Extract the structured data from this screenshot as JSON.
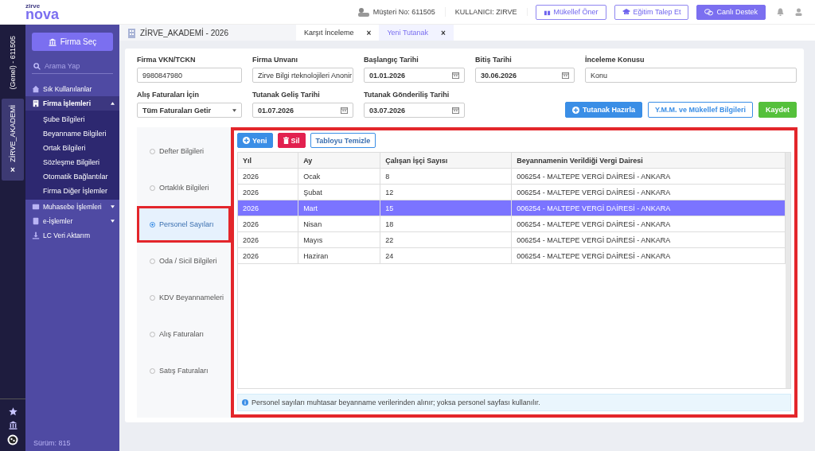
{
  "header": {
    "logo_small": "zirve",
    "logo": "nova",
    "customer": "Müşteri No: 611505",
    "user": "KULLANICI: ZIRVE",
    "buttons": [
      {
        "label": "Mükellef Öner",
        "kind": "outline"
      },
      {
        "label": "Eğitim Talep Et",
        "kind": "outline"
      },
      {
        "label": "Canlı Destek",
        "kind": "filled"
      }
    ]
  },
  "rail": {
    "label": "(Genel) - 611505",
    "tab": "ZİRVE_AKADEMİ",
    "close": "×"
  },
  "sidebar": {
    "select_button": "Firma Seç",
    "search": {
      "placeholder": "Arama Yap"
    },
    "items": [
      {
        "label": "Sık Kullanılanlar",
        "expanded": false
      },
      {
        "label": "Firma İşlemleri",
        "expanded": true,
        "children": [
          {
            "label": "Şube Bilgileri"
          },
          {
            "label": "Beyanname Bilgileri"
          },
          {
            "label": "Ortak Bilgileri"
          },
          {
            "label": "Sözleşme Bilgileri"
          },
          {
            "label": "Otomatik Bağlantılar"
          },
          {
            "label": "Firma Diğer İşlemler"
          }
        ]
      },
      {
        "label": "Muhasebe İşlemleri",
        "expanded": false,
        "has_children": true
      },
      {
        "label": "e-İşlemler",
        "expanded": false,
        "has_children": true
      },
      {
        "label": "LC Veri Aktarım",
        "expanded": false
      }
    ],
    "version": "Sürüm: 815"
  },
  "company": "ZİRVE_AKADEMİ - 2026",
  "tabs": [
    {
      "label": "Karşıt İnceleme",
      "close": "×",
      "selected": false
    },
    {
      "label": "Yeni Tutanak",
      "close": "×",
      "selected": true
    }
  ],
  "form": {
    "fields": [
      {
        "label": "Firma VKN/TCKN",
        "value": "9980847980",
        "kind": "text"
      },
      {
        "label": "Firma Unvanı",
        "value": "Zirve Bilgi rteknolojileri Anonir",
        "kind": "text"
      },
      {
        "label": "Başlangıç Tarihi",
        "value": "01.01.2026",
        "kind": "date"
      },
      {
        "label": "Bitiş Tarihi",
        "value": "30.06.2026",
        "kind": "date"
      },
      {
        "label": "İnceleme Konusu",
        "value": "Konu",
        "kind": "text"
      },
      {
        "label": "Alış Faturaları İçin",
        "value": "Tüm Faturaları Getir",
        "kind": "select"
      },
      {
        "label": "Tutanak Geliş Tarihi",
        "value": "01.07.2026",
        "kind": "date"
      },
      {
        "label": "Tutanak Gönderiliş Tarihi",
        "value": "03.07.2026",
        "kind": "date"
      }
    ],
    "buttons": [
      {
        "label": "Tutanak Hazırla",
        "kind": "primary"
      },
      {
        "label": "Y.M.M. ve Mükellef Bilgileri",
        "kind": "outline"
      },
      {
        "label": "Kaydet",
        "kind": "success"
      }
    ]
  },
  "sections": [
    {
      "label": "Defter Bilgileri",
      "selected": false
    },
    {
      "label": "Ortaklık Bilgileri",
      "selected": false
    },
    {
      "label": "Personel Sayıları",
      "selected": true
    },
    {
      "label": "Oda / Sicil Bilgileri",
      "selected": false
    },
    {
      "label": "KDV Beyannameleri",
      "selected": false
    },
    {
      "label": "Alış Faturaları",
      "selected": false
    },
    {
      "label": "Satış Faturaları",
      "selected": false
    }
  ],
  "toolbar": [
    {
      "label": "Yeni",
      "kind": "add"
    },
    {
      "label": "Sil",
      "kind": "delete"
    },
    {
      "label": "Tabloyu Temizle",
      "kind": "clear"
    }
  ],
  "table": {
    "columns": [
      "Yıl",
      "Ay",
      "Çalışan İşçi Sayısı",
      "Beyannamenin Verildiği Vergi Dairesi"
    ],
    "rows": [
      {
        "cells": [
          "2026",
          "Ocak",
          "8",
          "006254 - MALTEPE VERGİ DAİRESİ - ANKARA"
        ],
        "selected": false
      },
      {
        "cells": [
          "2026",
          "Şubat",
          "12",
          "006254 - MALTEPE VERGİ DAİRESİ - ANKARA"
        ],
        "selected": false
      },
      {
        "cells": [
          "2026",
          "Mart",
          "15",
          "006254 - MALTEPE VERGİ DAİRESİ - ANKARA"
        ],
        "selected": true
      },
      {
        "cells": [
          "2026",
          "Nisan",
          "18",
          "006254 - MALTEPE VERGİ DAİRESİ - ANKARA"
        ],
        "selected": false
      },
      {
        "cells": [
          "2026",
          "Mayıs",
          "22",
          "006254 - MALTEPE VERGİ DAİRESİ - ANKARA"
        ],
        "selected": false
      },
      {
        "cells": [
          "2026",
          "Haziran",
          "24",
          "006254 - MALTEPE VERGİ DAİRESİ - ANKARA"
        ],
        "selected": false
      }
    ]
  },
  "note": "Personel sayıları muhtasar beyanname verilerinden alınır; yoksa personel sayfası kullanılır."
}
